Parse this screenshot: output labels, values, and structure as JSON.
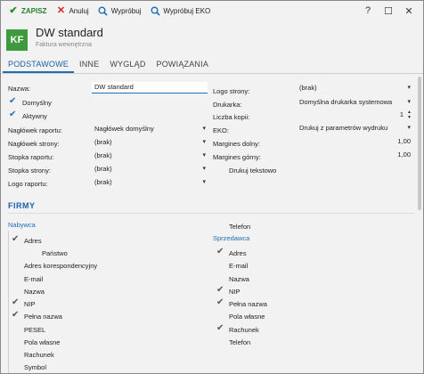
{
  "toolbar": {
    "save": "ZAPISZ",
    "cancel": "Anuluj",
    "try": "Wypróbuj",
    "try_eko": "Wypróbuj EKO"
  },
  "window_controls": {
    "help": "?",
    "maximize": "☐",
    "close": "✕"
  },
  "header": {
    "avatar": "KF",
    "title": "DW standard",
    "subtitle": "Faktura wewnętrzna"
  },
  "tabs": [
    "PODSTAWOWE",
    "INNE",
    "WYGLĄD",
    "POWIĄZANIA"
  ],
  "form_left": {
    "name_label": "Nazwa:",
    "name_value": "DW standard",
    "default_label": "Domyślny",
    "active_label": "Aktywny",
    "report_header_label": "Nagłówek raportu:",
    "report_header_value": "Nagłówek domyślny",
    "page_header_label": "Nagłówek strony:",
    "page_header_value": "(brak)",
    "report_footer_label": "Stopka raportu:",
    "report_footer_value": "(brak)",
    "page_footer_label": "Stopka strony:",
    "page_footer_value": "(brak)",
    "report_logo_label": "Logo raportu:",
    "report_logo_value": "(brak)"
  },
  "form_right": {
    "page_logo_label": "Logo strony:",
    "page_logo_value": "(brak)",
    "printer_label": "Drukarka:",
    "printer_value": "Domyślna drukarka systemowa",
    "copies_label": "Liczba kopii:",
    "copies_value": "1",
    "eko_label": "EKO:",
    "eko_value": "Drukuj z parametrów wydruku",
    "margin_bottom_label": "Margines dolny:",
    "margin_bottom_value": "1,00",
    "margin_top_label": "Margines górny:",
    "margin_top_value": "1,00",
    "print_text_label": "Drukuj tekstowo"
  },
  "firmy": {
    "title": "FIRMY",
    "buyer_title": "Nabywca",
    "seller_title": "Sprzedawca",
    "buyer_items": [
      {
        "label": "Adres",
        "checked": true
      },
      {
        "label": "Państwo",
        "checked": false
      },
      {
        "label": "Adres korespondencyjny",
        "checked": false
      },
      {
        "label": "E-mail",
        "checked": false
      },
      {
        "label": "Nazwa",
        "checked": false
      },
      {
        "label": "NIP",
        "checked": true
      },
      {
        "label": "Pełna nazwa",
        "checked": true
      },
      {
        "label": "PESEL",
        "checked": false
      },
      {
        "label": "Pola własne",
        "checked": false
      },
      {
        "label": "Rachunek",
        "checked": false
      },
      {
        "label": "Symbol",
        "checked": false
      }
    ],
    "buyer_phone": "Telefon",
    "seller_items": [
      {
        "label": "Adres",
        "checked": true
      },
      {
        "label": "E-mail",
        "checked": false
      },
      {
        "label": "Nazwa",
        "checked": false
      },
      {
        "label": "NIP",
        "checked": true
      },
      {
        "label": "Pełna nazwa",
        "checked": true
      },
      {
        "label": "Pola własne",
        "checked": false
      },
      {
        "label": "Rachunek",
        "checked": true
      },
      {
        "label": "Telefon",
        "checked": false
      }
    ]
  },
  "colors": {
    "accent": "#1e6fb7",
    "avatar": "#3d9a3d",
    "save": "#2a7d2a",
    "cancel": "#dd2222"
  }
}
